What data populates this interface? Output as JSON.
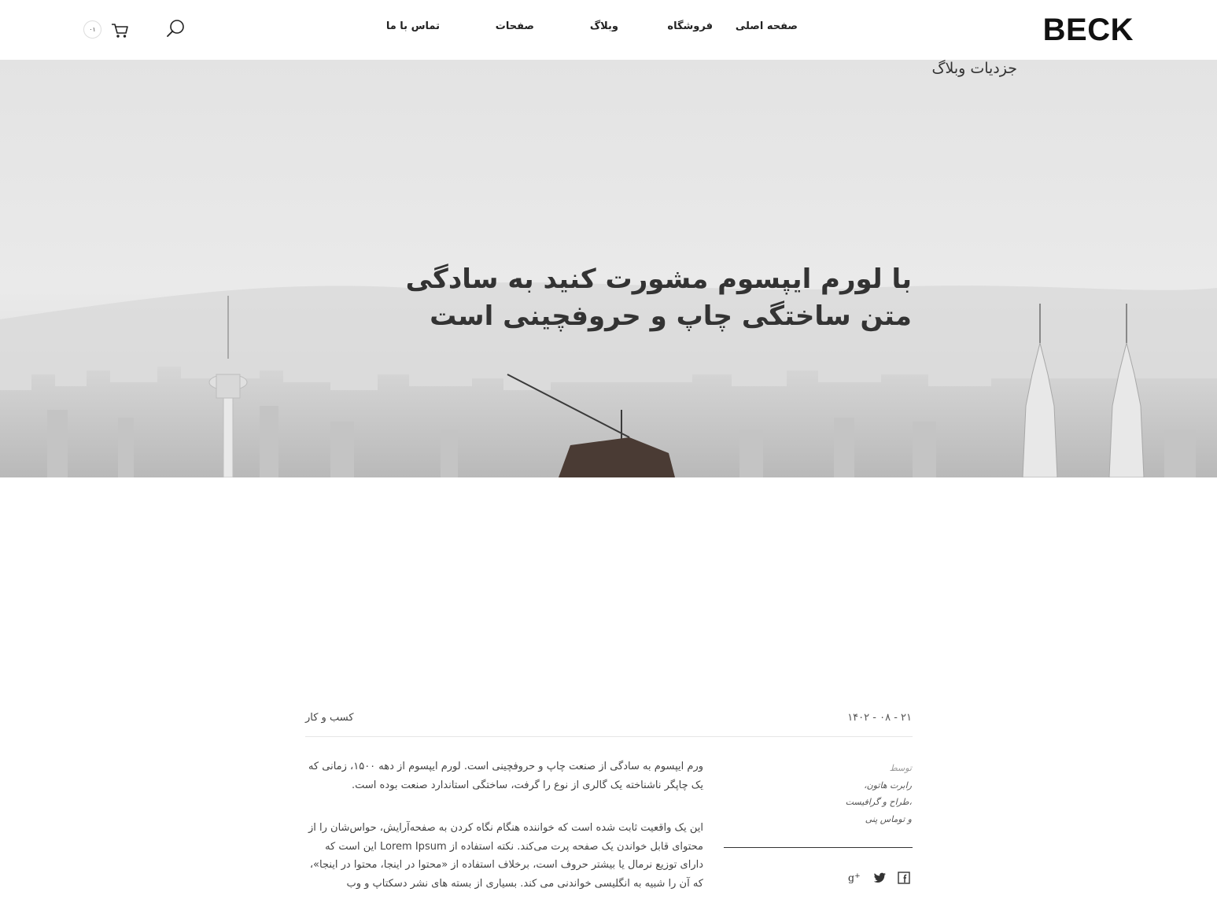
{
  "header": {
    "logo": "BECK",
    "nav": {
      "home": "صفحه اصلی",
      "shop": "فروشگاه",
      "blog": "وبلاگ",
      "pages": "صفحات",
      "contact": "تماس با ما"
    },
    "search_icon": "search-icon",
    "cart_icon": "cart-icon",
    "cart_count": "۰۱"
  },
  "hero": {
    "breadcrumb_title": "جزدیات وبلاگ",
    "title": "با لورم ایپسوم مشورت کنید به سادگی متن ساختگی چاپ و حروفچینی است"
  },
  "post_meta": {
    "date": "۲۱ - ۰۸ - ۱۴۰۲",
    "category": "کسب و کار"
  },
  "author": {
    "by_label": "توسط",
    "line1": "رابرت هاتون،",
    "line2": "،طراح و گرافیست",
    "line3": "و توماس پنی"
  },
  "social": [
    "facebook-icon",
    "twitter-icon",
    "google-plus-icon"
  ],
  "article": {
    "paragraph1": "ورم ایپسوم به سادگی از صنعت چاپ و حروفچینی است. لورم ایپسوم از دهه ۱۵۰۰، زمانی که یک چاپگر ناشناخته یک گالری از نوع را گرفت، ساختگی استاندارد صنعت بوده است.",
    "paragraph2": "این یک واقعیت ثابت شده است که خواننده هنگام نگاه کردن به صفحه‌آرایش، حواس‌شان را از محتوای قابل خواندن یک صفحه پرت می‌کند. نکته استفاده از Lorem Ipsum این است که دارای توزیع نرمال یا بیشتر حروف است، برخلاف استفاده از «محتوا در اینجا، محتوا در اینجا»، که آن را شبیه به انگلیسی خواندنی می کند. بسیاری از بسته های نشر دسکتاپ و وب"
  },
  "colors": {
    "text": "#222222",
    "muted": "#999999",
    "rule": "#e6e6e6",
    "hero_sky": "#e6e6e6"
  }
}
